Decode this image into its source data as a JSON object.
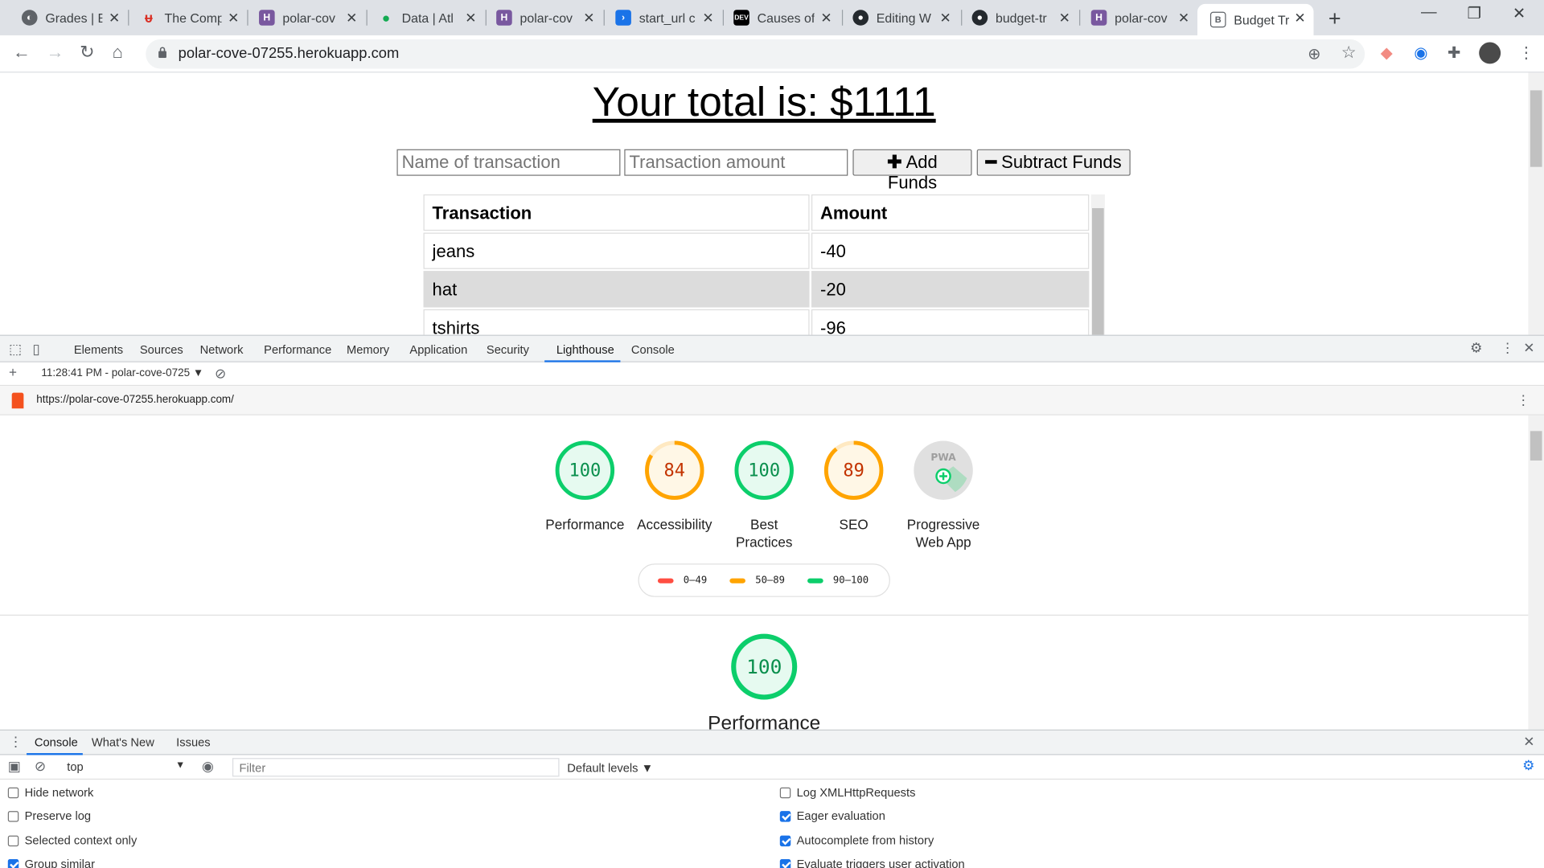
{
  "browser": {
    "tabs": [
      {
        "title": "Grades | B",
        "icon": "globe-icon",
        "color": "#5f6368"
      },
      {
        "title": "The Comp",
        "icon": "u-logo-icon",
        "color": "#d93025"
      },
      {
        "title": "polar-cov",
        "icon": "heroku-icon",
        "color": "#79589f"
      },
      {
        "title": "Data | Atl",
        "icon": "mongodb-leaf-icon",
        "color": "#13aa52"
      },
      {
        "title": "polar-cov",
        "icon": "heroku-icon",
        "color": "#79589f"
      },
      {
        "title": "start_url c",
        "icon": "terminal-icon",
        "color": "#1a73e8"
      },
      {
        "title": "Causes of",
        "icon": "dev-icon",
        "color": "#000000"
      },
      {
        "title": "Editing W",
        "icon": "github-icon",
        "color": "#24292e"
      },
      {
        "title": "budget-tr",
        "icon": "github-icon",
        "color": "#24292e"
      },
      {
        "title": "polar-cov",
        "icon": "heroku-icon",
        "color": "#79589f"
      },
      {
        "title": "Budget Tr",
        "icon": "page-icon",
        "color": "#5f6368"
      }
    ],
    "new_tab": "+",
    "url": "polar-cove-07255.herokuapp.com"
  },
  "page": {
    "total_text": "Your total is: $1111",
    "name_placeholder": "Name of transaction",
    "amount_placeholder": "Transaction amount",
    "add_funds": "Add Funds",
    "subtract_funds": "Subtract Funds",
    "table": {
      "headers": [
        "Transaction",
        "Amount"
      ],
      "rows": [
        {
          "name": "jeans",
          "amount": "-40"
        },
        {
          "name": "hat",
          "amount": "-20"
        },
        {
          "name": "tshirts",
          "amount": "-96"
        }
      ]
    }
  },
  "devtools": {
    "tabs": [
      "Elements",
      "Sources",
      "Network",
      "Performance",
      "Memory",
      "Application",
      "Security",
      "Lighthouse",
      "Console"
    ],
    "active_tab": "Lighthouse",
    "report_selector": "11:28:41 PM - polar-cove-0725",
    "report_url": "https://polar-cove-07255.herokuapp.com/",
    "scores": [
      {
        "label": "Performance",
        "score": 100,
        "color": "#0cce6b"
      },
      {
        "label": "Accessibility",
        "score": 84,
        "color": "#ffa400"
      },
      {
        "label": "Best Practices",
        "score": 100,
        "color": "#0cce6b"
      },
      {
        "label": "SEO",
        "score": 89,
        "color": "#ffa400"
      },
      {
        "label": "Progressive Web App",
        "score": null,
        "color": "#e0e0e0"
      }
    ],
    "pwa_badge": "PWA",
    "legend": [
      {
        "range": "0–49",
        "color": "#ff4e42"
      },
      {
        "range": "50–89",
        "color": "#ffa400"
      },
      {
        "range": "90–100",
        "color": "#0cce6b"
      }
    ],
    "perf_score": 100,
    "perf_title": "Performance",
    "drawer": {
      "tabs": [
        "Console",
        "What's New",
        "Issues"
      ],
      "context": "top",
      "filter_placeholder": "Filter",
      "levels": "Default levels ▼",
      "left_options": [
        {
          "label": "Hide network",
          "checked": false
        },
        {
          "label": "Preserve log",
          "checked": false
        },
        {
          "label": "Selected context only",
          "checked": false
        },
        {
          "label": "Group similar",
          "checked": true
        }
      ],
      "right_options": [
        {
          "label": "Log XMLHttpRequests",
          "checked": false
        },
        {
          "label": "Eager evaluation",
          "checked": true
        },
        {
          "label": "Autocomplete from history",
          "checked": true
        },
        {
          "label": "Evaluate triggers user activation",
          "checked": true
        }
      ]
    }
  }
}
